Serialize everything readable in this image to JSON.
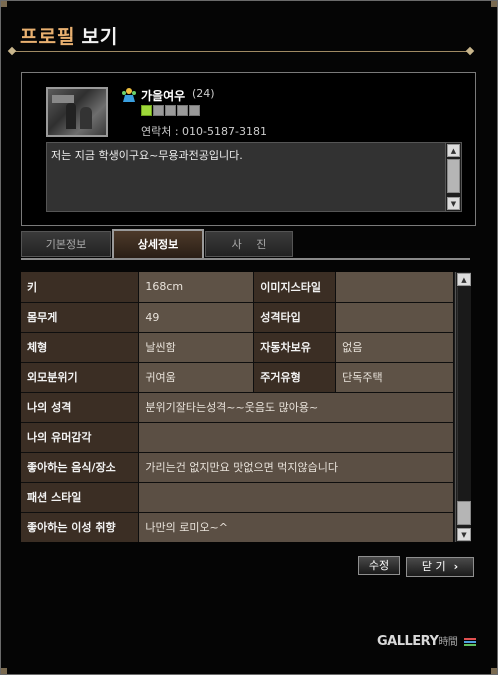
{
  "title": {
    "part1": "프로필",
    "part2": "보기"
  },
  "profile": {
    "nickname": "가을여우",
    "age": "(24)",
    "level_filled": 1,
    "level_total": 5,
    "contact": "연락처 : 010-5187-3181",
    "intro": "저는 지금 학생이구요~무용과전공입니다."
  },
  "tabs": [
    {
      "label": "기본정보",
      "active": false
    },
    {
      "label": "상세정보",
      "active": true
    },
    {
      "label": "사　 진",
      "active": false
    }
  ],
  "details": {
    "rows": [
      {
        "label1": "키",
        "value1": "168cm",
        "label2": "이미지스타일",
        "value2": ""
      },
      {
        "label1": "몸무게",
        "value1": "49",
        "label2": "성격타입",
        "value2": ""
      },
      {
        "label1": "체형",
        "value1": "날씬함",
        "label2": "자동차보유",
        "value2": "없음"
      },
      {
        "label1": "외모분위기",
        "value1": "귀여움",
        "label2": "주거유형",
        "value2": "단독주택"
      }
    ],
    "wide_rows": [
      {
        "label": "나의 성격",
        "value": "분위기잘타는성격~~웃음도 많아용~"
      },
      {
        "label": "나의 유머감각",
        "value": ""
      },
      {
        "label": "좋아하는 음식/장소",
        "value": "가리는건 없지만요 맛없으면 먹지않습니다"
      },
      {
        "label": "패션 스타일",
        "value": ""
      },
      {
        "label": "좋아하는 이성 취향",
        "value": "나만의 로미오~^"
      }
    ]
  },
  "buttons": {
    "edit": "수정",
    "close": "닫 기"
  },
  "brand": {
    "main": "GALLERY",
    "sub": "時間"
  },
  "colors": {
    "title_accent": "#e8b070",
    "label_bg": "#3b2e24",
    "value_bg": "#5e5246",
    "level_on": "#9fd93a"
  }
}
